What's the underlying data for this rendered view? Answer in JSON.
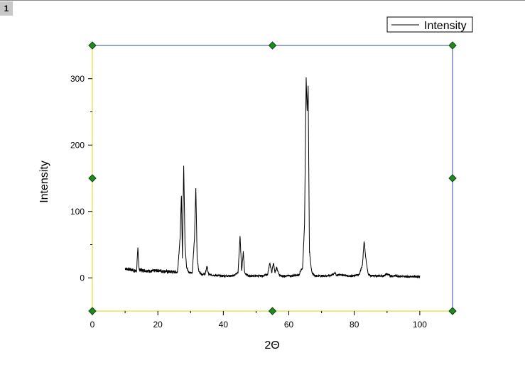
{
  "window": {
    "tab_label": "1"
  },
  "colors": {
    "frame_left": "#d8d800",
    "frame_bottom": "#d8d800",
    "frame_top": "#2c4ea8",
    "frame_right": "#2c4ea8",
    "handle": "#1e8a1e",
    "line": "#000000"
  },
  "chart_data": {
    "type": "line",
    "xlabel": "2Θ",
    "ylabel": "Intensity",
    "xlim": [
      0,
      110
    ],
    "ylim": [
      -50,
      350
    ],
    "xticks": [
      0,
      20,
      40,
      60,
      80,
      100
    ],
    "yticks": [
      0,
      100,
      200,
      300
    ],
    "legend": {
      "entries": [
        "Intensity"
      ],
      "placement": "top-right, outside plot"
    },
    "grid": false,
    "series": [
      {
        "name": "Intensity",
        "x": [
          10,
          12,
          13.5,
          13.9,
          14.3,
          16,
          18,
          20,
          22,
          24,
          26,
          26.8,
          27.2,
          27.5,
          27.9,
          28.3,
          28.8,
          29.5,
          30.5,
          31.2,
          31.6,
          32,
          32.5,
          33.5,
          34.5,
          35,
          35.5,
          37,
          39,
          41,
          43,
          44.5,
          45.1,
          45.6,
          46.1,
          46.5,
          47.5,
          50,
          52,
          53.5,
          54.2,
          54.8,
          55.3,
          55.8,
          56.3,
          57,
          57.5,
          59,
          61,
          63,
          64.2,
          64.8,
          65.3,
          65.6,
          65.9,
          66.3,
          67,
          68,
          70,
          72,
          73.5,
          74,
          74.5,
          76,
          78,
          80,
          81.5,
          82.5,
          83,
          83.5,
          84.2,
          85,
          87,
          89,
          90,
          91,
          93,
          95,
          97,
          99,
          100
        ],
        "y": [
          14,
          12,
          10,
          45,
          12,
          11,
          10,
          11,
          10,
          9,
          9,
          60,
          125,
          30,
          170,
          50,
          15,
          8,
          8,
          60,
          136,
          30,
          10,
          5,
          6,
          18,
          5,
          4,
          3,
          3,
          3,
          8,
          63,
          10,
          40,
          8,
          3,
          3,
          3,
          5,
          22,
          8,
          23,
          8,
          15,
          5,
          3,
          3,
          3,
          4,
          15,
          80,
          302,
          250,
          290,
          40,
          8,
          3,
          3,
          3,
          5,
          8,
          4,
          5,
          3,
          3,
          5,
          20,
          56,
          30,
          6,
          3,
          3,
          3,
          6,
          3,
          3,
          2,
          2,
          2,
          2
        ]
      }
    ]
  }
}
